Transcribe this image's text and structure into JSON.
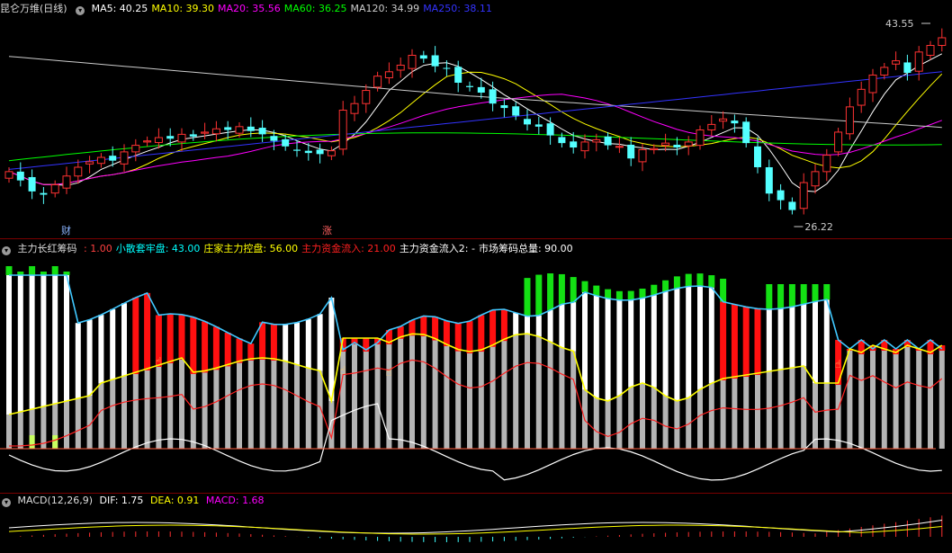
{
  "main": {
    "title": "昆仑万维(日线)",
    "ma": [
      {
        "label": "MA5: 40.25",
        "color": "#ffffff"
      },
      {
        "label": "MA10: 39.30",
        "color": "#ffff00"
      },
      {
        "label": "MA20: 35.56",
        "color": "#ff00ff"
      },
      {
        "label": "MA60: 36.25",
        "color": "#00ff00"
      },
      {
        "label": "MA120: 34.99",
        "color": "#cccccc"
      },
      {
        "label": "MA250: 38.11",
        "color": "#3333ff"
      }
    ],
    "high_label": "43.55",
    "low_label": "26.22",
    "marker_cai": "财",
    "marker_zhang": "涨"
  },
  "indicator": {
    "title": "主力长红筹码",
    "items": [
      {
        "label": ": 1.00",
        "color": "#ff4040"
      },
      {
        "label": "小散套牢盘: 43.00",
        "color": "#00ffff"
      },
      {
        "label": "庄家主力控盘: 56.00",
        "color": "#ffff00"
      },
      {
        "label": "主力资金流入: 21.00",
        "color": "#ff2020"
      },
      {
        "label": "主力资金流入2: -",
        "color": "#ffffff"
      },
      {
        "label": "市场筹码总量: 90.00",
        "color": "#ffffff"
      }
    ]
  },
  "macd": {
    "title": "MACD(12,26,9)",
    "dif": "DIF: 1.75",
    "dea": "DEA: 0.91",
    "macd": "MACD: 1.68"
  },
  "chart_data": {
    "type": "candlestick",
    "close": [
      31.0,
      30.2,
      29.2,
      28.9,
      29.8,
      30.6,
      31.4,
      31.9,
      32.3,
      32.0,
      32.8,
      33.4,
      33.8,
      34.1,
      34.0,
      34.4,
      34.2,
      34.6,
      34.9,
      34.8,
      35.1,
      34.7,
      34.4,
      33.8,
      33.3,
      32.9,
      32.7,
      32.6,
      32.9,
      36.6,
      37.2,
      38.4,
      39.7,
      40.1,
      40.7,
      41.6,
      41.3,
      40.6,
      40.4,
      39.1,
      38.7,
      38.2,
      37.2,
      36.8,
      36.1,
      35.3,
      35.1,
      34.3,
      33.6,
      33.2,
      33.7,
      33.9,
      33.4,
      33.3,
      32.2,
      33.0,
      33.1,
      33.6,
      33.2,
      33.7,
      34.8,
      35.3,
      35.8,
      35.4,
      33.6,
      31.4,
      29.0,
      28.4,
      27.5,
      30.0,
      31.0,
      32.5,
      34.6,
      36.9,
      38.5,
      39.8,
      40.5,
      41.1,
      40.0,
      41.9,
      42.5,
      43.2
    ],
    "price_range": [
      26.22,
      43.55
    ],
    "indicator_series": [
      "小散套牢盘",
      "庄家主力控盘",
      "主力资金流入",
      "主力资金流入2",
      "市场筹码总量"
    ],
    "macd": {
      "DIF": 1.75,
      "DEA": 0.91,
      "MACD": 1.68
    }
  }
}
